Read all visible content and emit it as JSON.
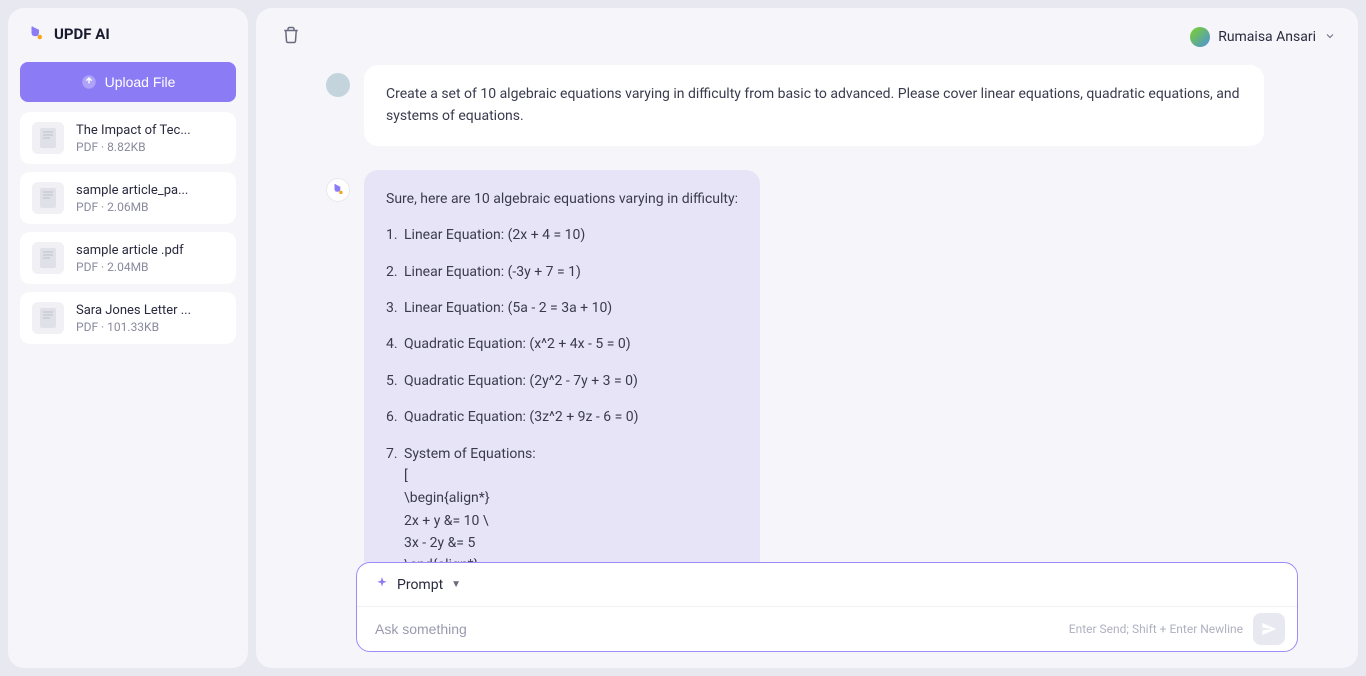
{
  "app": {
    "title": "UPDF AI"
  },
  "sidebar": {
    "upload_label": "Upload File",
    "files": [
      {
        "name": "The Impact of Tec...",
        "meta": "PDF · 8.82KB"
      },
      {
        "name": "sample article_pa...",
        "meta": "PDF · 2.06MB"
      },
      {
        "name": "sample article .pdf",
        "meta": "PDF · 2.04MB"
      },
      {
        "name": "Sara Jones Letter ...",
        "meta": "PDF · 101.33KB"
      }
    ]
  },
  "header": {
    "user_name": "Rumaisa Ansari"
  },
  "chat": {
    "user_message": "Create a set of 10 algebraic equations varying in difficulty from basic to advanced. Please cover linear equations, quadratic equations, and systems of equations.",
    "ai_intro": "Sure, here are 10 algebraic equations varying in difficulty:",
    "ai_items": [
      {
        "num": "1.",
        "text": "Linear Equation: (2x + 4 = 10)"
      },
      {
        "num": "2.",
        "text": "Linear Equation: (-3y + 7 = 1)"
      },
      {
        "num": "3.",
        "text": "Linear Equation: (5a - 2 = 3a + 10)"
      },
      {
        "num": "4.",
        "text": "Quadratic Equation: (x^2 + 4x - 5 = 0)"
      },
      {
        "num": "5.",
        "text": "Quadratic Equation: (2y^2 - 7y + 3 = 0)"
      },
      {
        "num": "6.",
        "text": "Quadratic Equation: (3z^2 + 9z - 6 = 0)"
      }
    ],
    "ai_item7_num": "7.",
    "ai_item7_text": "System of Equations:",
    "ai_item7_lines": [
      "[",
      "\\begin{align*}",
      "2x + y &= 10 \\",
      "3x - 2y &= 5",
      "\\end{align*}"
    ]
  },
  "input": {
    "prompt_label": "Prompt",
    "placeholder": "Ask something",
    "hint": "Enter Send; Shift + Enter Newline"
  }
}
